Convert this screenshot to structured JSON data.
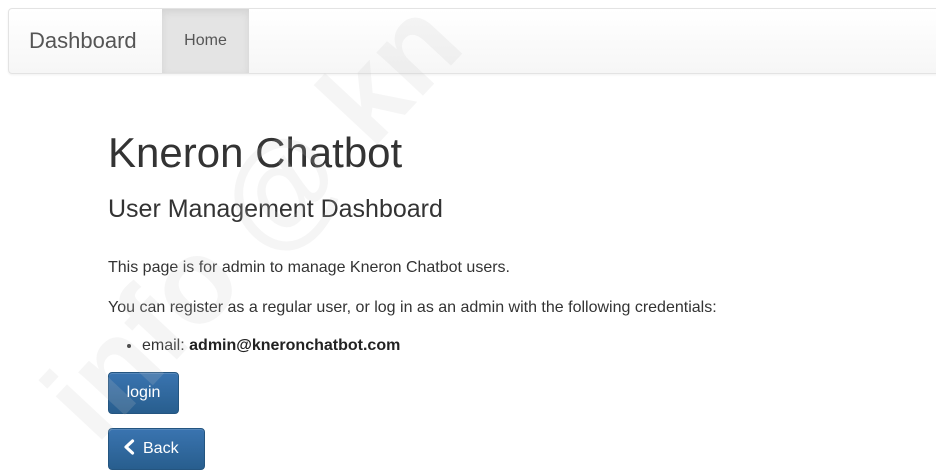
{
  "navbar": {
    "brand": "Dashboard",
    "home_label": "Home"
  },
  "main": {
    "title": "Kneron Chatbot",
    "subtitle": "User Management Dashboard",
    "intro": "This page is for admin to manage Kneron Chatbot users.",
    "instructions": "You can register as a regular user, or log in as an admin with the following credentials:",
    "credentials": [
      {
        "label": "email:",
        "value": "admin@kneronchatbot.com"
      }
    ],
    "login_label": "login",
    "back_label": "Back"
  },
  "watermark": {
    "text": "info @ kn"
  },
  "colors": {
    "button_primary": "#2e6da4",
    "navbar_bg": "#f8f8f8",
    "text": "#333333"
  },
  "icons": {
    "back": "chevron-left-icon"
  }
}
